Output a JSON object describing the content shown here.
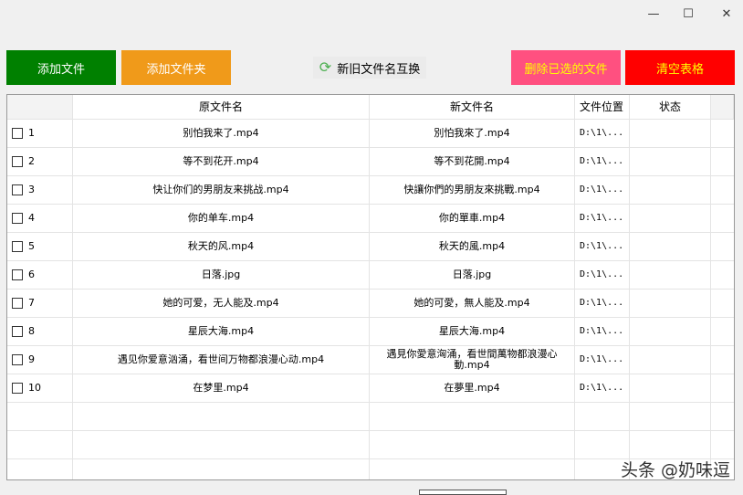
{
  "window": {
    "minimize": "—",
    "maximize": "☐",
    "close": "✕"
  },
  "toolbar": {
    "add_file": "添加文件",
    "add_folder": "添加文件夹",
    "swap": "新旧文件名互换",
    "delete_selected": "删除已选的文件",
    "clear_table": "清空表格"
  },
  "colors": {
    "add_file": "#008000",
    "add_folder": "#f09a1a",
    "delete_selected": "#ff5080",
    "clear_table": "#ff0000",
    "yellow_text": "#ffff00"
  },
  "table": {
    "headers": [
      "",
      "原文件名",
      "新文件名",
      "文件位置",
      "状态"
    ],
    "rows": [
      {
        "index": "1",
        "original": "别怕我来了.mp4",
        "new": "別怕我來了.mp4",
        "location": "D:\\1\\...",
        "status": ""
      },
      {
        "index": "2",
        "original": "等不到花开.mp4",
        "new": "等不到花開.mp4",
        "location": "D:\\1\\...",
        "status": ""
      },
      {
        "index": "3",
        "original": "快让你们的男朋友来挑战.mp4",
        "new": "快讓你們的男朋友來挑戰.mp4",
        "location": "D:\\1\\...",
        "status": ""
      },
      {
        "index": "4",
        "original": "你的单车.mp4",
        "new": "你的單車.mp4",
        "location": "D:\\1\\...",
        "status": ""
      },
      {
        "index": "5",
        "original": "秋天的风.mp4",
        "new": "秋天的風.mp4",
        "location": "D:\\1\\...",
        "status": ""
      },
      {
        "index": "6",
        "original": "日落.jpg",
        "new": "日落.jpg",
        "location": "D:\\1\\...",
        "status": ""
      },
      {
        "index": "7",
        "original": "她的可爱，无人能及.mp4",
        "new": "她的可愛，無人能及.mp4",
        "location": "D:\\1\\...",
        "status": ""
      },
      {
        "index": "8",
        "original": "星辰大海.mp4",
        "new": "星辰大海.mp4",
        "location": "D:\\1\\...",
        "status": ""
      },
      {
        "index": "9",
        "original": "遇见你爱意汹涌，看世间万物都浪漫心动.mp4",
        "new": "遇見你愛意洶涌，看世間萬物都浪漫心動.mp4",
        "location": "D:\\1\\...",
        "status": ""
      },
      {
        "index": "10",
        "original": "在梦里.mp4",
        "new": "在夢里.mp4",
        "location": "D:\\1\\...",
        "status": ""
      }
    ]
  },
  "watermark": "头条 @奶味逗"
}
